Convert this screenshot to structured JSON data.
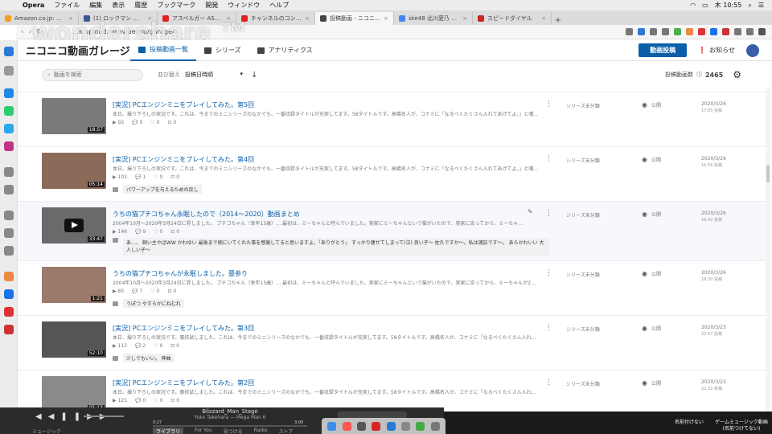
{
  "menubar": {
    "app": "Opera",
    "items": [
      "ファイル",
      "編集",
      "表示",
      "履歴",
      "ブックマーク",
      "開発",
      "ウィンドウ",
      "ヘルプ"
    ],
    "clock": "木 10:55"
  },
  "tabs": [
    {
      "label": "Amazon.co.jp: 掘ムーの世界ド",
      "color": "#f0a020"
    },
    {
      "label": "(1) ロックマン ロックマン",
      "color": "#3b5998"
    },
    {
      "label": "アスベルガー ASDロックマン",
      "color": "#e02020"
    },
    {
      "label": "チャンネルのコンテンツ - You",
      "color": "#e02020"
    },
    {
      "label": "投稿動画 - ニコニコ動画",
      "color": "#444444",
      "active": true
    },
    {
      "label": "ske48 北川愛乃 髪 - Google 検",
      "color": "#4285f4"
    },
    {
      "label": "スピードダイヤル",
      "color": "#cc2222"
    }
  ],
  "address": {
    "url": "…k.upload.nicovideo.jp/garage/"
  },
  "watermark": "wondershare ™",
  "header": {
    "logo": "ニコニコ動画ガレージ",
    "nav": [
      "投稿動画一覧",
      "シリーズ",
      "アナリティクス"
    ],
    "post_button": "動画投稿",
    "notice": "お知らせ"
  },
  "toolbar": {
    "search_placeholder": "動画を検索",
    "sort_label": "並び替え",
    "sort_value": "投稿日時順",
    "sort_direction": "↓",
    "total_label": "投稿動画数",
    "total_count": "2465"
  },
  "videos": [
    {
      "title": "[実況] PCエンジンミニをプレイしてみた。第5回",
      "desc": "本日、撮り下ろしの実況です。これは、今までのミニシリーズのなかでも、一番収録タイトルが充実してます。58タイトルです。高橋名人が、コナミに「なるべくたくさん入れてあげてよ。」と嘆願…",
      "duration": "18:57",
      "stats": [
        "▶ 92",
        "💬 0",
        "♡ 0",
        "⊡ 0"
      ],
      "comment": "",
      "series": "シリーズ未分類",
      "visibility": "公開",
      "date": "2020/3/26",
      "time": "17:05 投稿",
      "thumb": "#7a7a7a"
    },
    {
      "title": "[実況] PCエンジンミニをプレイしてみた。第4回",
      "desc": "本日、撮り下ろしの実況です。これは、今までのミニシリーズのなかでも、一番収録タイトルが充実してます。58タイトルです。高橋名人が、コナミに「なるべくたくさん入れてあげてよ。」と嘆願…",
      "duration": "05:14",
      "stats": [
        "▶ 103",
        "💬 1",
        "♡ 0",
        "⊡ 0"
      ],
      "comment": "パワーアップを与えるための戻し",
      "series": "シリーズ未分類",
      "visibility": "公開",
      "date": "2020/3/26",
      "time": "16:58 投稿",
      "thumb": "#8c6a5a"
    },
    {
      "title": "うちの猫プチコちゃん永眠したので（2014〜2020）動画まとめ",
      "desc": "2004年10月〜2020年3月24日に昇しました。 プチコちゃん（享年15歳）….最初は、ミーちゃんと呼んでいました。実家にミーちゃんという猫がいたので、実家に戻ってから、ミーちゃ…",
      "duration": "33:47",
      "stats": [
        "▶ 146",
        "💬 9",
        "♡ 0",
        "⊡ 0"
      ],
      "comment": "あ…、 飼い主やばWW かわゆい 最後まで側にいてくれた事を感謝してると思いますよ。「ありがとう」 すっかり痩せてしまって(泣)  良い子〜 佐久ですか〜。私は諏訪です〜。 あらかわいい 大人しい子〜",
      "series": "シリーズ未分類",
      "visibility": "公開",
      "date": "2020/3/26",
      "time": "16:42 投稿",
      "thumb": "#6a6a6a",
      "highlight": true,
      "play": true
    },
    {
      "title": "うちの猫プチコちゃんが永眠しました。墓参り",
      "desc": "2004年10月〜2020年3月24日に昇しました。 プチコちゃん（享年15歳）….最初は、ミーちゃんと呼んでいました。実家にミーちゃんという猫がいたので、実家に戻ってから、ミーちゃんが2匹…",
      "duration": "1:21",
      "stats": [
        "▶ 85",
        "💬 7",
        "♡ 0",
        "⊡ 0"
      ],
      "comment": "うぽつ  やすらかにねむれ",
      "series": "シリーズ未分類",
      "visibility": "公開",
      "date": "2020/3/26",
      "time": "16:30 投稿",
      "thumb": "#9a7a6a"
    },
    {
      "title": "[実況] PCエンジンミニをプレイしてみた。第3回",
      "desc": "本日、撮り下ろしの実況です。裏技試しました。これは、今までのミニシリーズのなかでも、一番収録タイトルが充実してます。58タイトルです。高橋名人が、コナミに「なるべくたくさん入れて…",
      "duration": "52:10",
      "stats": [
        "▶ 113",
        "💬 2",
        "♡ 0",
        "⊡ 0"
      ],
      "comment": "少しでもいい。 神曲",
      "series": "シリーズ未分類",
      "visibility": "公開",
      "date": "2020/3/23",
      "time": "22:57 投稿",
      "thumb": "#555555"
    },
    {
      "title": "[実況] PCエンジンミニをプレイしてみた。第2回",
      "desc": "本日、撮り下ろしの実況です。裏技試しました。これは、今までのミニシリーズのなかでも、一番収録タイトルが充実してます。58タイトルです。高橋名人が、コナミに「なるべくたくさん入れて…",
      "duration": "05:13",
      "stats": [
        "▶ 121",
        "💬 0",
        "♡ 0",
        "⊡ 0"
      ],
      "comment": "",
      "series": "シリーズ未分類",
      "visibility": "公開",
      "date": "2020/3/23",
      "time": "22:32 投稿",
      "thumb": "#8a8a8a"
    }
  ],
  "music": {
    "track": "Blizzard_Man_Stage",
    "artist": "Yuko Takehara — Mega Man 6",
    "elapsed": "0:27",
    "remaining": "3:00",
    "library": "ミュージック",
    "tabs": [
      "ライブラリ",
      "For You",
      "見つける",
      "Radio",
      "ストア"
    ]
  },
  "desktop_labels": [
    "名前付けない",
    "ゲームミュージック動画 (名前つけてない)"
  ]
}
